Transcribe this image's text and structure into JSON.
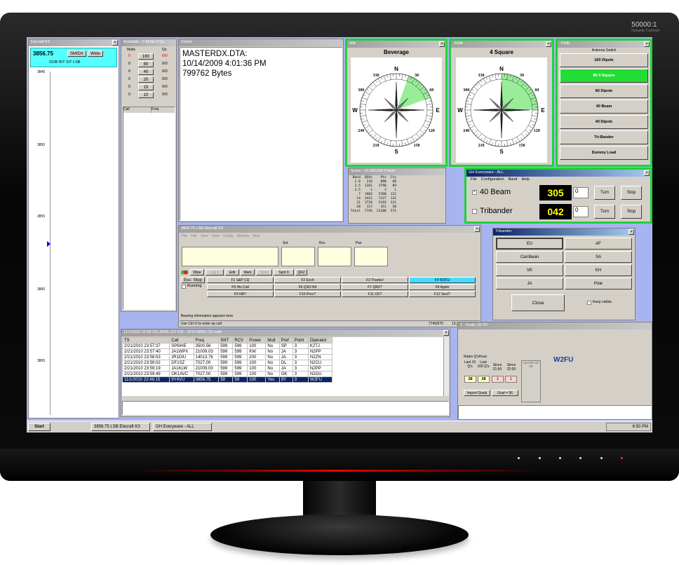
{
  "monitor": {
    "brand": "50000:1",
    "brand_sub": "Dynamic Contrast"
  },
  "k3": {
    "title": "Elecraft K3",
    "freq": "3856.75",
    "mode_btn": "SM/DX",
    "wide_btn": "Wide",
    "status": "OOB RIT XIT LSB",
    "ticks": [
      "3845",
      "3850",
      "3855",
      "3860",
      "3865"
    ]
  },
  "mults": {
    "title": "Available - 0 Mults 0 Qs",
    "h_mults": "Mults",
    "h_qs": "Qs",
    "rows": [
      {
        "m": "0",
        "band": "160",
        "q": "0/0"
      },
      {
        "m": "0",
        "band": "80",
        "q": "0/0"
      },
      {
        "m": "0",
        "band": "40",
        "q": "0/0"
      },
      {
        "m": "0",
        "band": "20",
        "q": "0/0"
      },
      {
        "m": "0",
        "band": "15",
        "q": "0/0"
      },
      {
        "m": "0",
        "band": "10",
        "q": "0/0"
      }
    ],
    "col_call": "Call",
    "col_freq": "Freq"
  },
  "check": {
    "title": "Check",
    "lines": [
      "MASTERDX.DTA:",
      "10/14/2009 4:01:36 PM",
      "799762 Bytes"
    ]
  },
  "beverage": {
    "title": "0db",
    "name": "Beverage",
    "compass": [
      "N",
      "E",
      "S",
      "W",
      "30",
      "60",
      "120",
      "150",
      "210",
      "240",
      "300",
      "330"
    ]
  },
  "foursq": {
    "title": "-53db",
    "name": "4 Square"
  },
  "antsw": {
    "title": "-53db",
    "header": "Antenna Switch",
    "items": [
      "160 Dipole",
      "80 4 Square",
      "80 Dipole",
      "40 Beam",
      "40 Dipole",
      "Tri-Bander",
      "Dummy Load"
    ],
    "active": "80 4 Square"
  },
  "score": {
    "title": "Score : 13,282,500 Points",
    "head": [
      "Band",
      "QSOs",
      "Pts",
      "Cty"
    ],
    "rows": [
      [
        "1.8",
        "218",
        "888",
        "68"
      ],
      [
        "3.5",
        "1261",
        "3798",
        "89"
      ],
      [
        "3.5",
        "1",
        "3",
        "1"
      ],
      [
        "7",
        "1903",
        "5700",
        "122"
      ],
      [
        "14",
        "2411",
        "7227",
        "131"
      ],
      [
        "21",
        "1734",
        "5193",
        "111"
      ],
      [
        "28",
        "117",
        "351",
        "50"
      ],
      [
        "Total",
        "7745",
        "23100",
        "571"
      ]
    ]
  },
  "ghe": {
    "title": "GH Everyware - ALL",
    "menu": [
      "File",
      "Configuration",
      "Band",
      "Help"
    ],
    "rows": [
      {
        "name": "40 Beam",
        "heading": "305",
        "spin": "0",
        "turn": "Turn",
        "stop": "Stop",
        "checked": "✓"
      },
      {
        "name": "Tribander",
        "heading": "042",
        "spin": "0",
        "turn": "Turn",
        "stop": "Stop",
        "checked": ""
      }
    ]
  },
  "entry": {
    "title": "3856.75 LSB Elecraft K3",
    "menu": [
      "File",
      "Edit",
      "View",
      "Tools",
      "Config",
      "Window",
      "Help"
    ],
    "lbl_snt": "Snt",
    "lbl_rcv": "Rcv",
    "lbl_pwr": "Pwr",
    "toolbar": [
      "Wipe",
      "Log It",
      "Edit",
      "Mark",
      "Store",
      "Spot It",
      "QRZ"
    ],
    "esc": "Esc: Stop",
    "running": "Running",
    "fkeys": [
      "F1 S&P CQ",
      "F2 Exch",
      "F3 Thanks!",
      "F4 W2FU",
      "F5 His Call",
      "F6 QSO B4",
      "F7 QRZ?",
      "F8 Again",
      "F9 NR?",
      "F10 Prec?",
      "F11 CK?",
      "F12 Sect?"
    ],
    "fkey_active": "F4 W2FU",
    "bearing": "Bearing information appears here",
    "prompt": "Use Ctrl-O to enter op call",
    "status1": "7745/575",
    "status2": "13,282,500"
  },
  "tribander": {
    "title": "Tribander",
    "btns": [
      "EU",
      "AF",
      "Carribean",
      "SA",
      "VK",
      "KH",
      "JA",
      "Pole"
    ],
    "close": "Close",
    "keep": "Keep visible"
  },
  "log": {
    "title": "11/1/2010 22:58:262  ARRL DX CW - 2010  ARRL DX.mdb",
    "cols": [
      "TS",
      "Call",
      "Freq",
      "SNT",
      "RCV",
      "Power",
      "Mult",
      "Pref",
      "Point",
      "Operator"
    ],
    "rows": [
      [
        "2/21/2010 23:57:37",
        "SP6IHE",
        "3500.56",
        "599",
        "599",
        "100",
        "No",
        "SP",
        "3",
        "K2TJ"
      ],
      [
        "2/21/2010 23:57:40",
        "JA1WPX",
        "21009.03",
        "599",
        "599",
        "KW",
        "No",
        "JA",
        "3",
        "N2PP"
      ],
      [
        "2/21/2010 23:58:53",
        "JR1DIU",
        "14013.76",
        "599",
        "599",
        "200",
        "No",
        "JA",
        "3",
        "N2ZN"
      ],
      [
        "2/21/2010 23:59:02",
        "DF1SZ",
        "7027.00",
        "599",
        "599",
        "100",
        "No",
        "DL",
        "3",
        "N2CU"
      ],
      [
        "2/21/2010 23:59:19",
        "JA1KLW",
        "21009.03",
        "599",
        "599",
        "100",
        "No",
        "JA",
        "3",
        "N2PP"
      ],
      [
        "2/21/2010 23:59:49",
        "OK1AVC",
        "7027.00",
        "599",
        "599",
        "100",
        "No",
        "OK",
        "3",
        "N2GU"
      ],
      [
        "11/1/2010 22:48:15",
        "9Y4VU",
        "3856.75",
        "59",
        "59",
        "100",
        "Yes",
        "9Y",
        "3",
        "W2FU"
      ]
    ]
  },
  "rates": {
    "title": "1 - Radio 1B NY",
    "rates_lbl": "Rates",
    "qsh_lbl": "Q's/hour",
    "last10": "Last 10 Q's",
    "last100": "Last 100 Q's",
    "since1": "Since 21:50",
    "since2": "Since 22:00",
    "lastmin": "Last 60 min",
    "v1": "28",
    "v2": "28",
    "v3": "1",
    "v4": "1",
    "v5": "56",
    "import": "Import Goals",
    "goal": "Goal = 56",
    "op": "W2FU"
  },
  "taskbar": {
    "start": "Start",
    "items": [
      "3856.75 LSB Elecraft K3",
      "GH Everyware - ALL"
    ],
    "clock": "6:50 PM"
  }
}
